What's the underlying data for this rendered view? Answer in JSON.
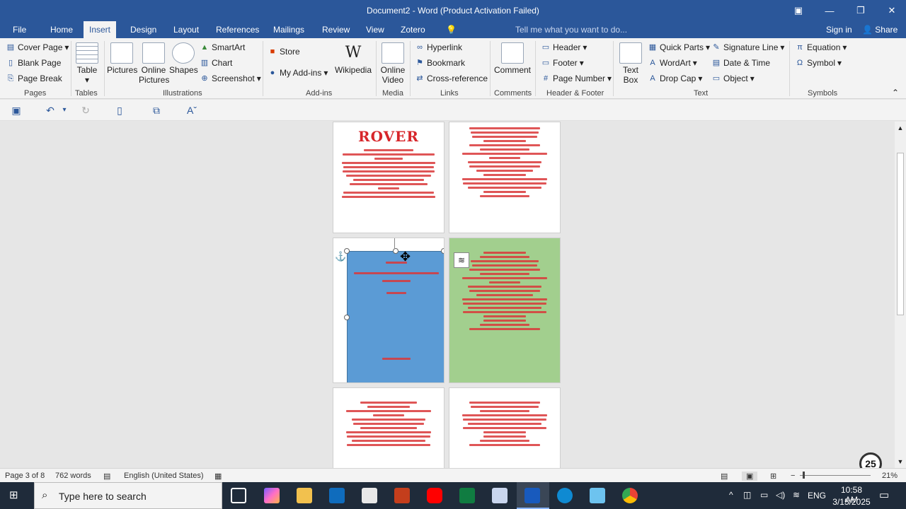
{
  "window": {
    "title": "Document2 - Word (Product Activation Failed)"
  },
  "tabs": {
    "file": "File",
    "home": "Home",
    "insert": "Insert",
    "design": "Design",
    "layout": "Layout",
    "references": "References",
    "mailings": "Mailings",
    "review": "Review",
    "view": "View",
    "zotero": "Zotero",
    "tell_me": "Tell me what you want to do...",
    "sign_in": "Sign in",
    "share": "Share"
  },
  "ribbon": {
    "pages": {
      "cover_page": "Cover Page",
      "blank_page": "Blank Page",
      "page_break": "Page Break",
      "label": "Pages"
    },
    "tables": {
      "table": "Table",
      "label": "Tables"
    },
    "illustrations": {
      "pictures": "Pictures",
      "online_pictures_1": "Online",
      "online_pictures_2": "Pictures",
      "shapes": "Shapes",
      "smartart": "SmartArt",
      "chart": "Chart",
      "screenshot": "Screenshot",
      "label": "Illustrations"
    },
    "addins": {
      "store": "Store",
      "my_addins": "My Add-ins",
      "wikipedia": "Wikipedia",
      "label": "Add-ins"
    },
    "media": {
      "online_video_1": "Online",
      "online_video_2": "Video",
      "label": "Media"
    },
    "links": {
      "hyperlink": "Hyperlink",
      "bookmark": "Bookmark",
      "cross_reference": "Cross-reference",
      "label": "Links"
    },
    "comments": {
      "comment": "Comment",
      "label": "Comments"
    },
    "header_footer": {
      "header": "Header",
      "footer": "Footer",
      "page_number": "Page Number",
      "label": "Header & Footer"
    },
    "text": {
      "text_box_1": "Text",
      "text_box_2": "Box",
      "quick_parts": "Quick Parts",
      "wordart": "WordArt",
      "drop_cap": "Drop Cap",
      "signature_line": "Signature Line",
      "date_time": "Date & Time",
      "object": "Object",
      "label": "Text"
    },
    "symbols": {
      "equation": "Equation",
      "symbol": "Symbol",
      "label": "Symbols"
    }
  },
  "document": {
    "heading": "ROVER"
  },
  "status": {
    "page": "Page 3 of 8",
    "words": "762 words",
    "language": "English (United States)",
    "zoom": "21%"
  },
  "taskbar": {
    "search_placeholder": "Type here to search",
    "lang": "ENG",
    "time": "10:58 AM",
    "date": "3/15/2025",
    "notification_count": "25"
  }
}
